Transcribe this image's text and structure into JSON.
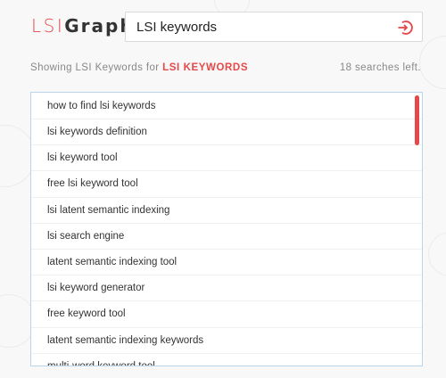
{
  "brand": {
    "prefix": "LSI",
    "accent": "Graph"
  },
  "search": {
    "value": "LSI keywords",
    "button_icon": "enter-circle-icon"
  },
  "status": {
    "prefix": "Showing LSI Keywords for",
    "keyword": "LSI KEYWORDS",
    "searches_left": "18 searches left."
  },
  "results": [
    "how to find lsi keywords",
    "lsi keywords definition",
    "lsi keyword tool",
    "free lsi keyword tool",
    "lsi latent semantic indexing",
    "lsi search engine",
    "latent semantic indexing tool",
    "lsi keyword generator",
    "free keyword tool",
    "latent semantic indexing keywords",
    "multi-word keyword tool"
  ],
  "colors": {
    "accent": "#e54848",
    "result_border": "#b9d6ee",
    "background": "#f9f8f8"
  }
}
